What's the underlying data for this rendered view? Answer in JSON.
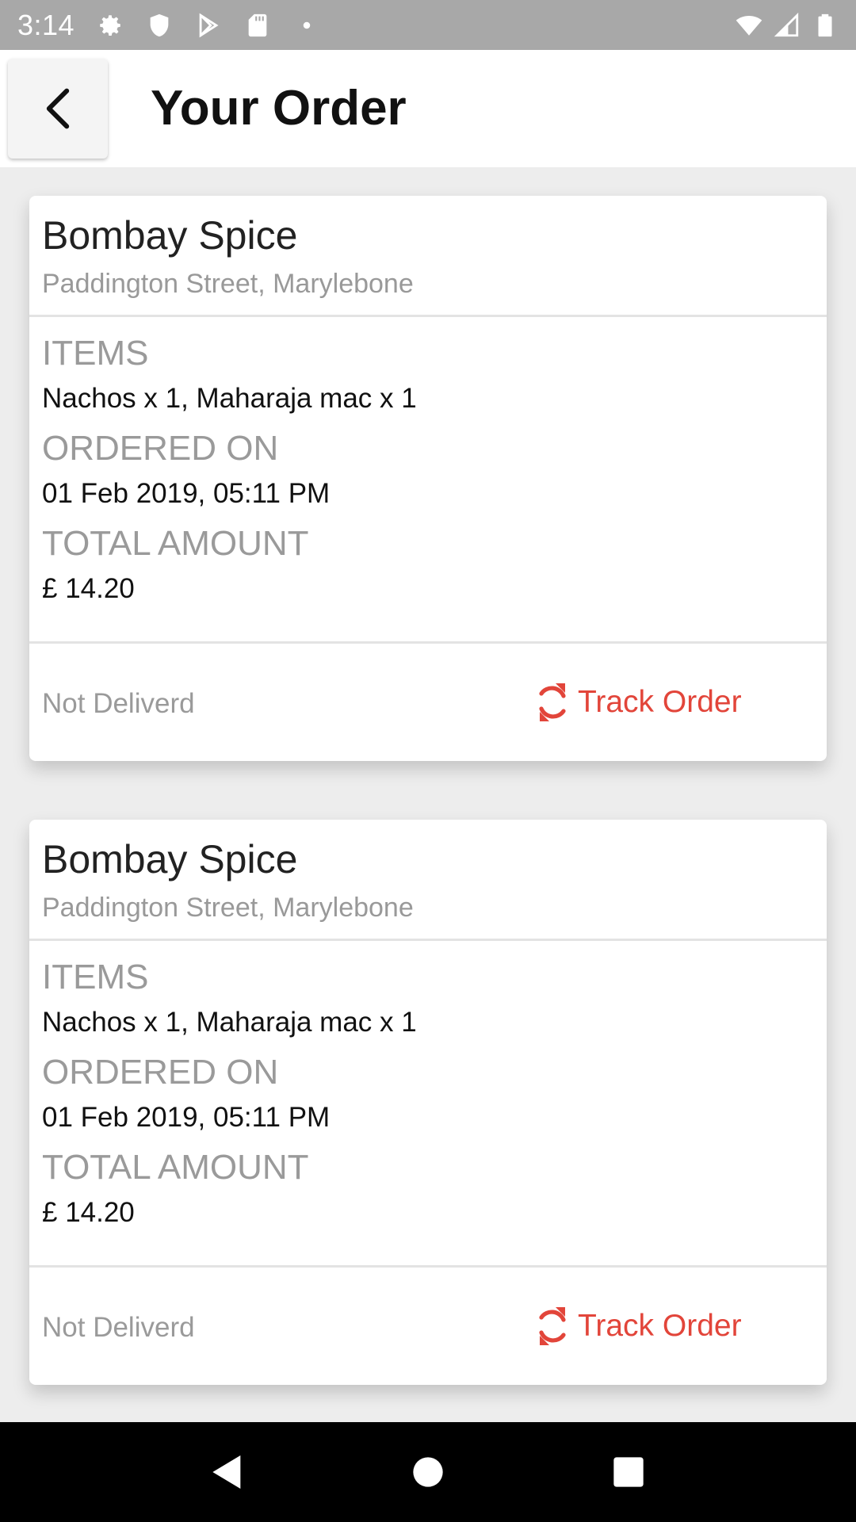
{
  "status_bar": {
    "time": "3:14",
    "left_icons": [
      "settings-icon",
      "shield-icon",
      "play-store-icon",
      "sd-card-icon",
      "dot-icon"
    ],
    "right_icons": [
      "wifi-icon",
      "signal-icon",
      "battery-icon"
    ]
  },
  "app_bar": {
    "back_icon": "chevron-left-icon",
    "title": "Your Order"
  },
  "orders": [
    {
      "restaurant": "Bombay Spice",
      "address": "Paddington Street, Marylebone",
      "items_label": "ITEMS",
      "items": "Nachos x 1, Maharaja mac x 1",
      "ordered_on_label": "ORDERED ON",
      "ordered_on": "01 Feb 2019, 05:11 PM",
      "total_label": "TOTAL AMOUNT",
      "total": "£ 14.20",
      "status": "Not Deliverd",
      "track_label": "Track Order"
    },
    {
      "restaurant": "Bombay Spice",
      "address": "Paddington Street, Marylebone",
      "items_label": "ITEMS",
      "items": "Nachos x 1, Maharaja mac x 1",
      "ordered_on_label": "ORDERED ON",
      "ordered_on": "01 Feb 2019, 05:11 PM",
      "total_label": "TOTAL AMOUNT",
      "total": "£ 14.20",
      "status": "Not Deliverd",
      "track_label": "Track Order"
    }
  ],
  "colors": {
    "accent": "#e2453a",
    "status_bar": "#a8a8a8",
    "background": "#ededed"
  },
  "nav_bar": {
    "icons": [
      "back-triangle-icon",
      "home-circle-icon",
      "recents-square-icon"
    ]
  }
}
